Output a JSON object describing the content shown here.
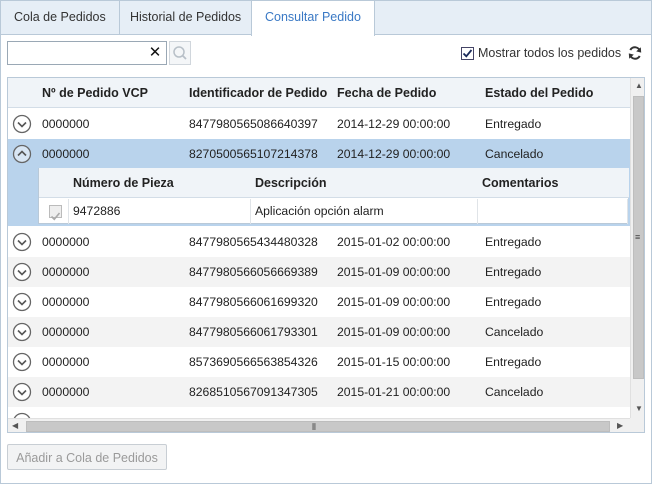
{
  "tabs": [
    {
      "label": "Cola de Pedidos"
    },
    {
      "label": "Historial de Pedidos"
    },
    {
      "label": "Consultar Pedido"
    }
  ],
  "toolbar": {
    "search_value": "",
    "show_all_label": "Mostrar todos los pedidos",
    "show_all_checked": true
  },
  "grid": {
    "columns": [
      "Nº de Pedido VCP",
      "Identificador de Pedido",
      "Fecha de Pedido",
      "Estado del Pedido"
    ],
    "rows": [
      {
        "vcp": "0000000",
        "id": "8477980565086640397",
        "date": "2014-12-29 00:00:00",
        "status": "Entregado"
      },
      {
        "vcp": "0000000",
        "id": "8270500565107214378",
        "date": "2014-12-29 00:00:00",
        "status": "Cancelado"
      },
      {
        "vcp": "0000000",
        "id": "8477980565434480328",
        "date": "2015-01-02 00:00:00",
        "status": "Entregado"
      },
      {
        "vcp": "0000000",
        "id": "8477980566056669389",
        "date": "2015-01-09 00:00:00",
        "status": "Entregado"
      },
      {
        "vcp": "0000000",
        "id": "8477980566061699320",
        "date": "2015-01-09 00:00:00",
        "status": "Entregado"
      },
      {
        "vcp": "0000000",
        "id": "8477980566061793301",
        "date": "2015-01-09 00:00:00",
        "status": "Cancelado"
      },
      {
        "vcp": "0000000",
        "id": "8573690566563854326",
        "date": "2015-01-15 00:00:00",
        "status": "Entregado"
      },
      {
        "vcp": "0000000",
        "id": "8268510567091347305",
        "date": "2015-01-21 00:00:00",
        "status": "Cancelado"
      }
    ],
    "detail": {
      "columns": [
        "Número de Pieza",
        "Descripción",
        "Comentarios"
      ],
      "rows": [
        {
          "part": "9472886",
          "description": "Aplicación opción alarm",
          "comments": ""
        }
      ]
    }
  },
  "actions": {
    "add_label": "Añadir a Cola de Pedidos"
  },
  "colors": {
    "accent": "#3a79c5",
    "selected_row": "#b9d3ec",
    "header_bg": "#f0f4f8"
  }
}
